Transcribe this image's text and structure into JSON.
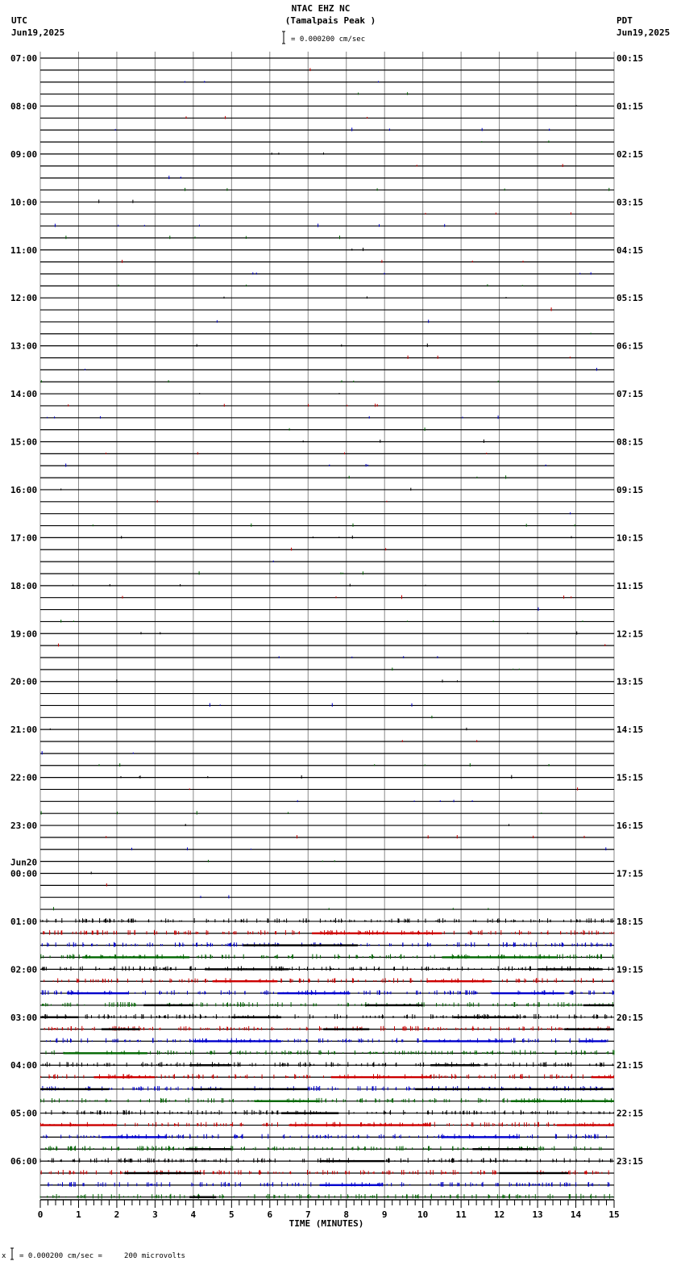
{
  "header": {
    "station": "NTAC EHZ NC",
    "site": "(Tamalpais Peak )",
    "left_tz": "UTC",
    "left_date": "Jun19,2025",
    "right_tz": "PDT",
    "right_date": "Jun19,2025",
    "scale": "= 0.000200 cm/sec"
  },
  "footer": {
    "scale": "= 0.000200 cm/sec =     200 microvolts",
    "marker": "x"
  },
  "chart_data": {
    "type": "line",
    "title": "NTAC EHZ NC (Tamalpais Peak )",
    "xlabel": "TIME (MINUTES)",
    "xlim": [
      0,
      15
    ],
    "x_ticks": [
      "0",
      "1",
      "2",
      "3",
      "4",
      "5",
      "6",
      "7",
      "8",
      "9",
      "10",
      "11",
      "12",
      "13",
      "14",
      "15"
    ],
    "traces_per_hour": 4,
    "trace_count": 96,
    "trace_colors": [
      "#000000",
      "#cc0000",
      "#0000cc",
      "#006600"
    ],
    "left_hour_labels": [
      "07:00",
      "08:00",
      "09:00",
      "10:00",
      "11:00",
      "12:00",
      "13:00",
      "14:00",
      "15:00",
      "16:00",
      "17:00",
      "18:00",
      "19:00",
      "20:00",
      "21:00",
      "22:00",
      "23:00",
      "00:00",
      "01:00",
      "02:00",
      "03:00",
      "04:00",
      "05:00",
      "06:00"
    ],
    "date_change_label": "Jun20",
    "date_change_hour_index": 17,
    "right_hour_labels": [
      "00:15",
      "01:15",
      "02:15",
      "03:15",
      "04:15",
      "05:15",
      "06:15",
      "07:15",
      "08:15",
      "09:15",
      "10:15",
      "11:15",
      "12:15",
      "13:15",
      "14:15",
      "15:15",
      "16:15",
      "17:15",
      "18:15",
      "19:15",
      "20:15",
      "21:15",
      "22:15",
      "23:15"
    ],
    "bursts": [
      [
        73,
        "#cc0000",
        7.1,
        10.5
      ],
      [
        74,
        "#000000",
        5.3,
        8.3
      ],
      [
        75,
        "#006600",
        1.1,
        3.9
      ],
      [
        75,
        "#006600",
        10.5,
        13.5
      ],
      [
        76,
        "#000000",
        4.3,
        6.5
      ],
      [
        76,
        "#000000",
        13.0,
        14.7
      ],
      [
        77,
        "#cc0000",
        4.5,
        6.2
      ],
      [
        77,
        "#cc0000",
        10.1,
        11.8
      ],
      [
        78,
        "#0000cc",
        0.7,
        2.3
      ],
      [
        78,
        "#0000cc",
        6.2,
        8.1
      ],
      [
        78,
        "#0000cc",
        11.8,
        13.7
      ],
      [
        79,
        "#000000",
        2.7,
        4.0
      ],
      [
        79,
        "#000000",
        8.5,
        10.0
      ],
      [
        79,
        "#000000",
        14.2,
        15
      ],
      [
        80,
        "#000000",
        0,
        1.0
      ],
      [
        80,
        "#000000",
        5.0,
        6.3
      ],
      [
        80,
        "#000000",
        10.8,
        12.5
      ],
      [
        81,
        "#000000",
        1.6,
        2.6
      ],
      [
        81,
        "#000000",
        7.4,
        8.6
      ],
      [
        81,
        "#000000",
        13.7,
        15
      ],
      [
        82,
        "#0000cc",
        4.0,
        6.3
      ],
      [
        82,
        "#0000cc",
        10.0,
        12.3
      ],
      [
        82,
        "#0000cc",
        14.1,
        14.8
      ],
      [
        83,
        "#006600",
        0.6,
        2.8
      ],
      [
        84,
        "#000000",
        3.9,
        5.0
      ],
      [
        84,
        "#000000",
        10.2,
        11.5
      ],
      [
        85,
        "#cc0000",
        1.4,
        3.0
      ],
      [
        85,
        "#cc0000",
        7.6,
        10.2
      ],
      [
        85,
        "#cc0000",
        14.4,
        15
      ],
      [
        86,
        "#000000",
        0,
        1.8
      ],
      [
        86,
        "#000000",
        4.0,
        7.0
      ],
      [
        86,
        "#000000",
        9.8,
        15
      ],
      [
        87,
        "#006600",
        5.6,
        7.3
      ],
      [
        87,
        "#006600",
        12.3,
        15
      ],
      [
        88,
        "#000000",
        6.3,
        7.8
      ],
      [
        89,
        "#cc0000",
        0,
        2.0
      ],
      [
        89,
        "#cc0000",
        6.5,
        10.2
      ],
      [
        89,
        "#cc0000",
        13.5,
        15
      ],
      [
        90,
        "#0000cc",
        1.6,
        3.3
      ],
      [
        90,
        "#0000cc",
        10.5,
        12.5
      ],
      [
        91,
        "#000000",
        3.8,
        5.0
      ],
      [
        91,
        "#000000",
        11.3,
        13.0
      ],
      [
        92,
        "#000000",
        7.3,
        9.0
      ],
      [
        93,
        "#000000",
        2.2,
        4.2
      ],
      [
        93,
        "#000000",
        12.0,
        13.8
      ],
      [
        94,
        "#0000cc",
        7.3,
        8.9
      ],
      [
        95,
        "#000000",
        3.9,
        4.6
      ]
    ]
  }
}
